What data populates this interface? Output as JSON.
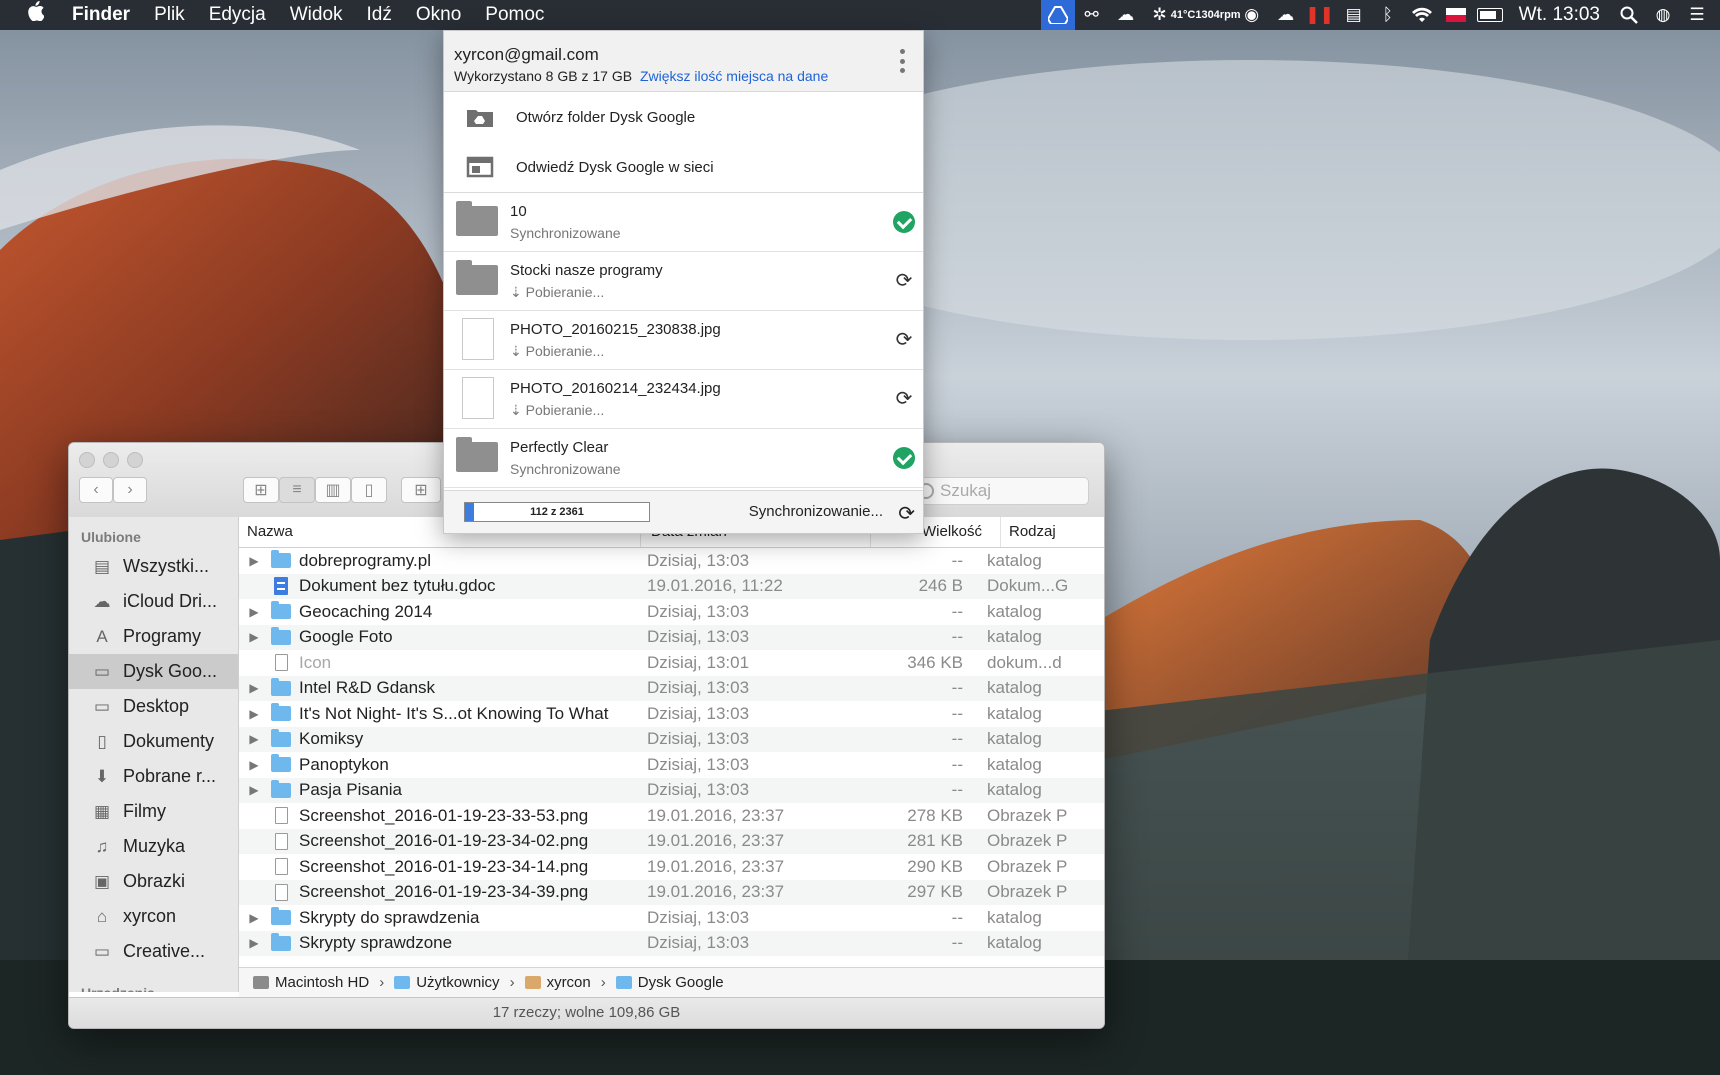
{
  "menubar": {
    "apple": "",
    "items": [
      "Finder",
      "Plik",
      "Edycja",
      "Widok",
      "Idź",
      "Okno",
      "Pomoc"
    ],
    "temp": "41°C",
    "rpm": "1304rpm",
    "clock": "Wt. 13:03",
    "icons": [
      "google-drive-icon",
      "link-icon",
      "cloud-sync-icon",
      "fan-icon",
      "sync-circle-icon",
      "cloud-icon",
      "pause-icon",
      "battery-icon",
      "bluetooth-icon",
      "wifi-icon",
      "flag-icon",
      "battery-charge-icon",
      "search-icon",
      "user-icon",
      "list-icon"
    ]
  },
  "popup": {
    "email": "xyrcon@gmail.com",
    "usage": "Wykorzystano 8 GB z 17 GB",
    "upgrade": "Zwiększ ilość miejsca na dane",
    "actions": [
      {
        "label": "Otwórz folder Dysk Google",
        "icon": "drive-folder-icon"
      },
      {
        "label": "Odwiedź Dysk Google w sieci",
        "icon": "browser-window-icon"
      }
    ],
    "items": [
      {
        "name": "10",
        "status": "Synchronizowane",
        "type": "folder",
        "state": "ok"
      },
      {
        "name": "Stocki nasze programy",
        "status": "⇣ Pobieranie...",
        "type": "folder",
        "state": "sync"
      },
      {
        "name": "PHOTO_20160215_230838.jpg",
        "status": "⇣ Pobieranie...",
        "type": "file",
        "state": "sync"
      },
      {
        "name": "PHOTO_20160214_232434.jpg",
        "status": "⇣ Pobieranie...",
        "type": "file",
        "state": "sync"
      },
      {
        "name": "Perfectly Clear",
        "status": "Synchronizowane",
        "type": "folder",
        "state": "ok"
      }
    ],
    "progress_text": "112 z 2361",
    "progress_done": 112,
    "progress_total": 2361,
    "footer_status": "Synchronizowanie..."
  },
  "finder": {
    "search_placeholder": "Szukaj",
    "sidebar": {
      "favorites_heading": "Ulubione",
      "devices_heading": "Urządzenia",
      "items": [
        {
          "label": "Wszystki...",
          "icon": "all-files-icon"
        },
        {
          "label": "iCloud Dri...",
          "icon": "icloud-icon"
        },
        {
          "label": "Programy",
          "icon": "applications-icon"
        },
        {
          "label": "Dysk Goo...",
          "icon": "folder-icon",
          "selected": true
        },
        {
          "label": "Desktop",
          "icon": "desktop-icon"
        },
        {
          "label": "Dokumenty",
          "icon": "documents-icon"
        },
        {
          "label": "Pobrane r...",
          "icon": "downloads-icon"
        },
        {
          "label": "Filmy",
          "icon": "movies-icon"
        },
        {
          "label": "Muzyka",
          "icon": "music-icon"
        },
        {
          "label": "Obrazki",
          "icon": "pictures-icon"
        },
        {
          "label": "xyrcon",
          "icon": "home-icon"
        },
        {
          "label": "Creative...",
          "icon": "folder-icon"
        }
      ]
    },
    "columns": {
      "name": "Nazwa",
      "date": "Data zmian",
      "size": "Wielkość",
      "kind": "Rodzaj"
    },
    "rows": [
      {
        "name": "dobreprogramy.pl",
        "date": "Dzisiaj, 13:03",
        "size": "--",
        "kind": "katalog",
        "type": "folder",
        "disclosure": true
      },
      {
        "name": "Dokument bez tytułu.gdoc",
        "date": "19.01.2016, 11:22",
        "size": "246 B",
        "kind": "Dokum...G",
        "type": "doc",
        "disclosure": false
      },
      {
        "name": "Geocaching 2014",
        "date": "Dzisiaj, 13:03",
        "size": "--",
        "kind": "katalog",
        "type": "folder",
        "disclosure": true
      },
      {
        "name": "Google Foto",
        "date": "Dzisiaj, 13:03",
        "size": "--",
        "kind": "katalog",
        "type": "folder",
        "disclosure": true
      },
      {
        "name": "Icon",
        "date": "Dzisiaj, 13:01",
        "size": "346 KB",
        "kind": "dokum...d",
        "type": "file",
        "disclosure": false,
        "dim": true
      },
      {
        "name": "Intel R&D Gdansk",
        "date": "Dzisiaj, 13:03",
        "size": "--",
        "kind": "katalog",
        "type": "folder",
        "disclosure": true
      },
      {
        "name": "It's Not Night- It's S...ot Knowing To What",
        "date": "Dzisiaj, 13:03",
        "size": "--",
        "kind": "katalog",
        "type": "folder",
        "disclosure": true
      },
      {
        "name": "Komiksy",
        "date": "Dzisiaj, 13:03",
        "size": "--",
        "kind": "katalog",
        "type": "folder",
        "disclosure": true
      },
      {
        "name": "Panoptykon",
        "date": "Dzisiaj, 13:03",
        "size": "--",
        "kind": "katalog",
        "type": "folder",
        "disclosure": true
      },
      {
        "name": "Pasja Pisania",
        "date": "Dzisiaj, 13:03",
        "size": "--",
        "kind": "katalog",
        "type": "folder",
        "disclosure": true
      },
      {
        "name": "Screenshot_2016-01-19-23-33-53.png",
        "date": "19.01.2016, 23:37",
        "size": "278 KB",
        "kind": "Obrazek P",
        "type": "file",
        "disclosure": false
      },
      {
        "name": "Screenshot_2016-01-19-23-34-02.png",
        "date": "19.01.2016, 23:37",
        "size": "281 KB",
        "kind": "Obrazek P",
        "type": "file",
        "disclosure": false
      },
      {
        "name": "Screenshot_2016-01-19-23-34-14.png",
        "date": "19.01.2016, 23:37",
        "size": "290 KB",
        "kind": "Obrazek P",
        "type": "file",
        "disclosure": false
      },
      {
        "name": "Screenshot_2016-01-19-23-34-39.png",
        "date": "19.01.2016, 23:37",
        "size": "297 KB",
        "kind": "Obrazek P",
        "type": "file",
        "disclosure": false
      },
      {
        "name": "Skrypty do sprawdzenia",
        "date": "Dzisiaj, 13:03",
        "size": "--",
        "kind": "katalog",
        "type": "folder",
        "disclosure": true
      },
      {
        "name": "Skrypty sprawdzone",
        "date": "Dzisiaj, 13:03",
        "size": "--",
        "kind": "katalog",
        "type": "folder",
        "disclosure": true
      }
    ],
    "path": [
      "Macintosh HD",
      "Użytkownicy",
      "xyrcon",
      "Dysk Google"
    ],
    "status": "17 rzeczy; wolne 109,86 GB"
  }
}
